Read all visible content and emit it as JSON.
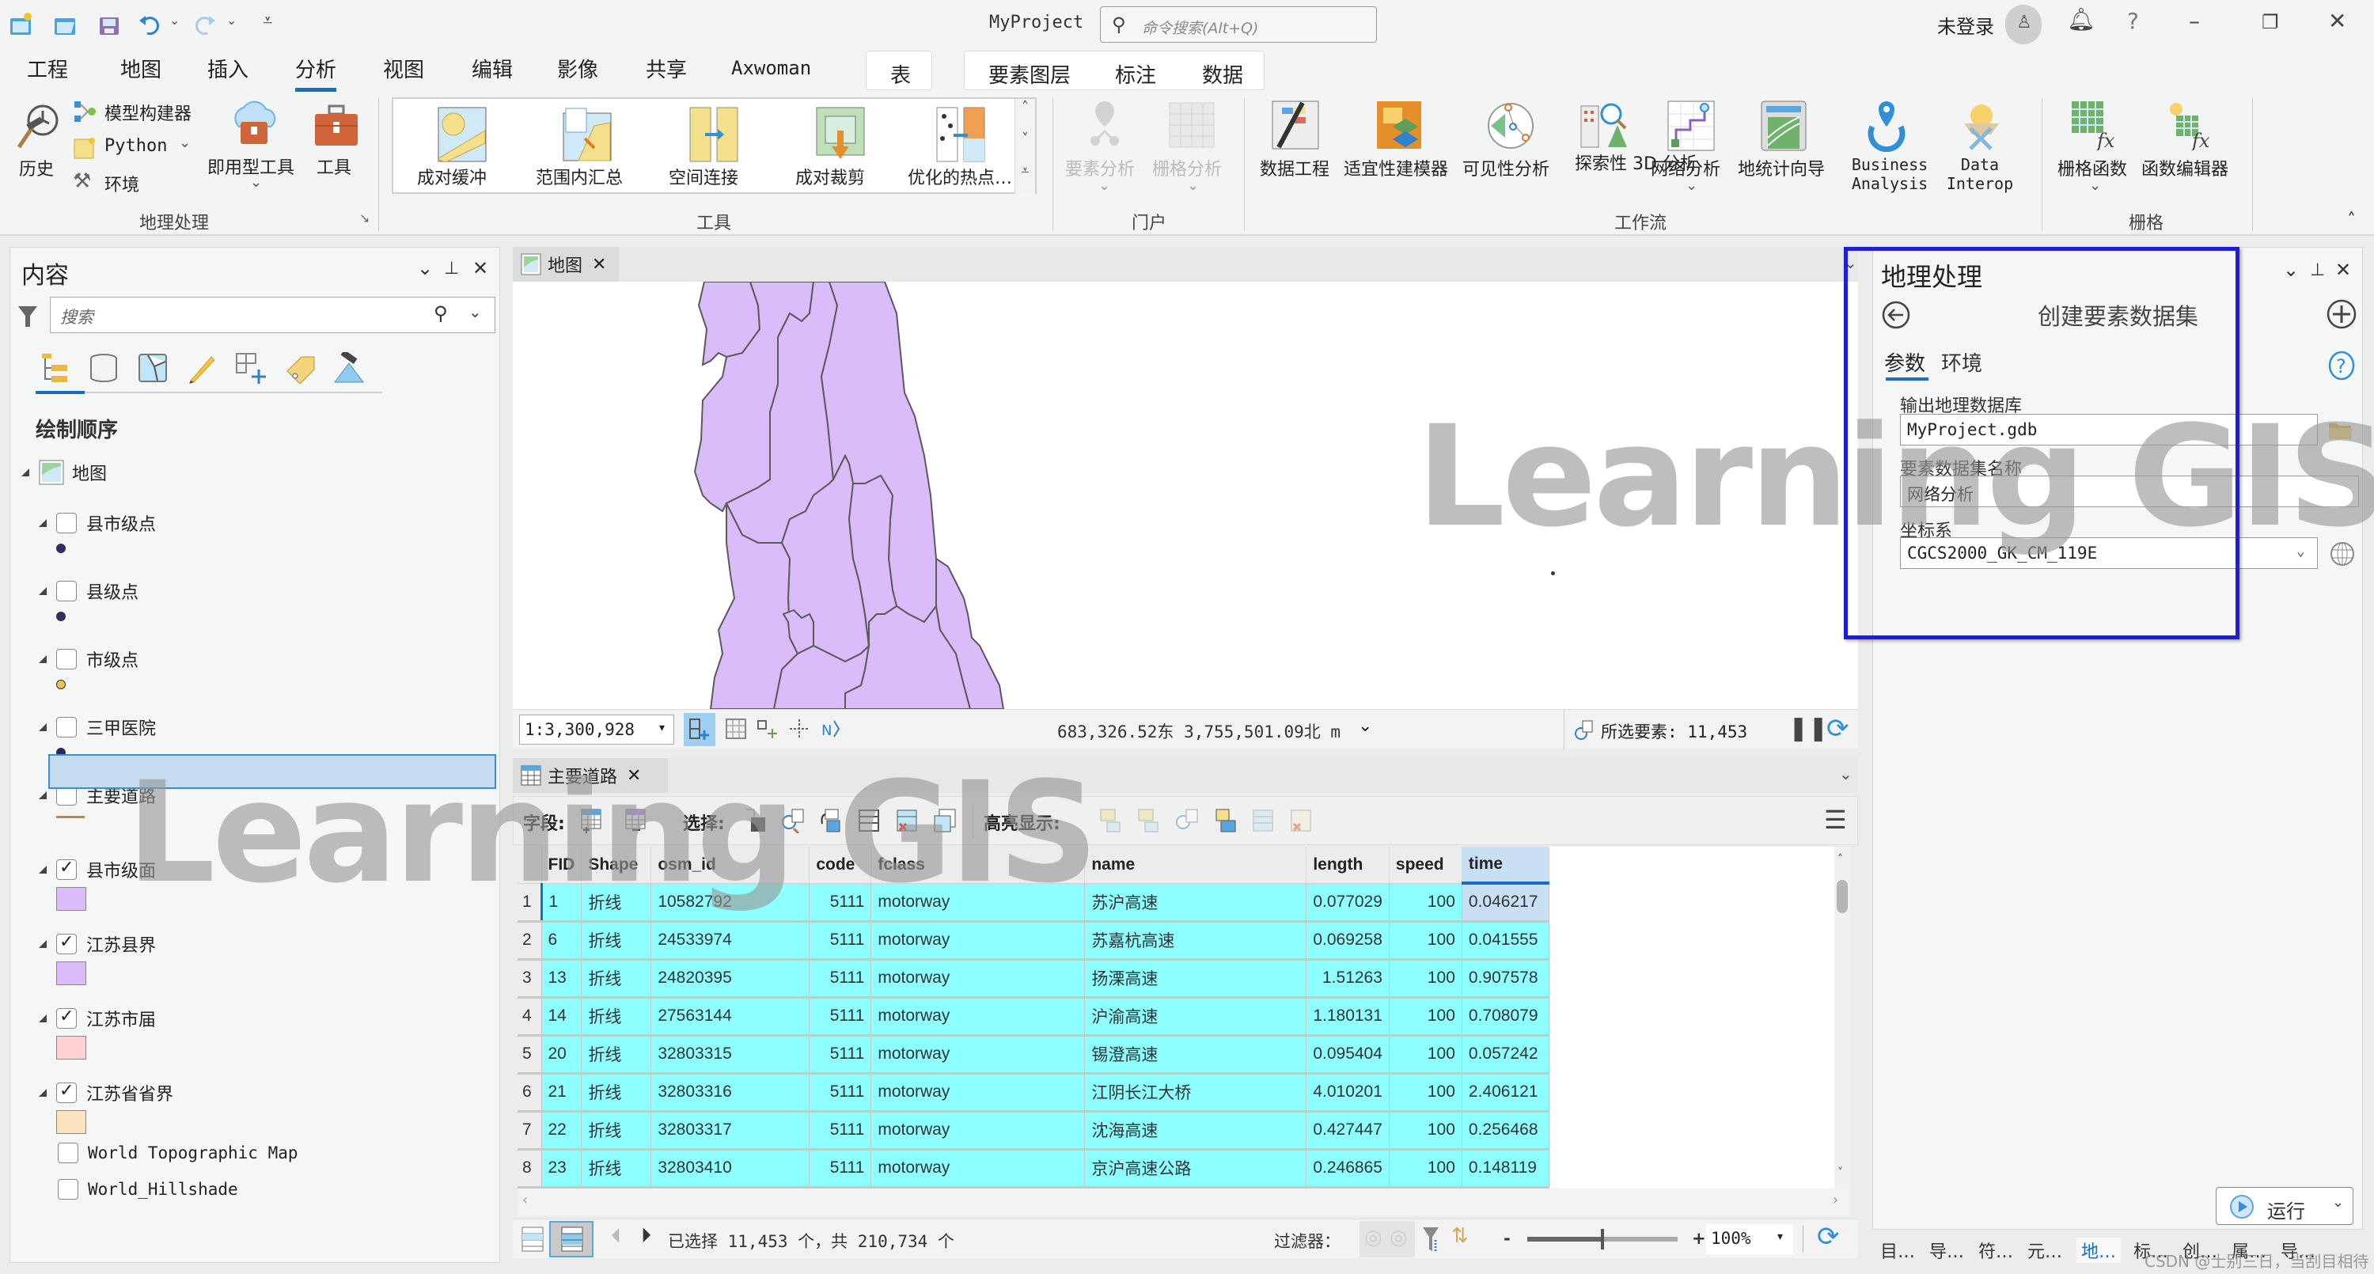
{
  "titlebar": {
    "project_name": "MyProject",
    "command_search_placeholder": "命令搜索(Alt+Q)",
    "user_status": "未登录",
    "help": "?"
  },
  "ribbon_tabs": {
    "items": [
      "工程",
      "地图",
      "插入",
      "分析",
      "视图",
      "编辑",
      "影像",
      "共享",
      "Axwoman"
    ],
    "active": "分析",
    "contextual": {
      "table": "表",
      "feature_layer_group": [
        "要素图层",
        "标注",
        "数据"
      ]
    }
  },
  "ribbon": {
    "geoprocessing": {
      "label": "地理处理",
      "history": "历史",
      "model_builder": "模型构建器",
      "python": "Python",
      "environments": "环境",
      "ready_tools": "即用型工具",
      "tools": "工具"
    },
    "tools_gallery": {
      "label": "工具",
      "items": [
        "成对缓冲",
        "范围内汇总",
        "空间连接",
        "成对裁剪",
        "优化的热点…"
      ]
    },
    "portal": {
      "label": "门户",
      "items": [
        "要素分析",
        "栅格分析"
      ]
    },
    "workflows": {
      "label": "工作流",
      "items": [
        "数据工程",
        "适宜性建模器",
        "可见性分析",
        "探索性 3D 分析",
        "网络分析",
        "地统计向导",
        "Business Analysis",
        "Data Interop"
      ]
    },
    "raster": {
      "label": "栅格",
      "items": [
        "栅格函数",
        "函数编辑器"
      ]
    }
  },
  "contents": {
    "title": "内容",
    "search_placeholder": "搜索",
    "section": "绘制顺序",
    "map_name": "地图",
    "layers": [
      {
        "name": "县市级点",
        "checked": false,
        "symbol": "dot",
        "color": "#3b2a6b"
      },
      {
        "name": "县级点",
        "checked": false,
        "symbol": "dot",
        "color": "#3b2a6b"
      },
      {
        "name": "市级点",
        "checked": false,
        "symbol": "dot",
        "color": "#e8c45a"
      },
      {
        "name": "三甲医院",
        "checked": false,
        "symbol": "dot",
        "color": "#1f2a6b"
      },
      {
        "name": "主要道路",
        "checked": false,
        "symbol": "line",
        "color": "#b8845a",
        "selected": true
      },
      {
        "name": "县市级面",
        "checked": true,
        "symbol": "fill",
        "color": "#dbbcfb"
      },
      {
        "name": "江苏县界",
        "checked": true,
        "symbol": "fill",
        "color": "#dbbcfb"
      },
      {
        "name": "江苏市届",
        "checked": true,
        "symbol": "fill",
        "color": "#fdd0d2"
      },
      {
        "name": "江苏省省界",
        "checked": true,
        "symbol": "fill",
        "color": "#fde3bd"
      }
    ],
    "basemaps": [
      {
        "name": "World Topographic Map",
        "checked": false
      },
      {
        "name": "World_Hillshade",
        "checked": false
      }
    ]
  },
  "map_view": {
    "tab_label": "地图",
    "scale": "1:3,300,928",
    "coordinates": "683,326.52东  3,755,501.09北 m",
    "selected_features": "所选要素: 11,453",
    "polygon_fill": "#dbbcfb"
  },
  "attribute_table": {
    "tab_label": "主要道路",
    "toolbar": {
      "field": "字段:",
      "select": "选择:",
      "highlight": "高亮显示:"
    },
    "columns": [
      "FID",
      "Shape",
      "osm_id",
      "code",
      "fclass",
      "name",
      "length",
      "speed",
      "time"
    ],
    "sorted_column": "time",
    "rows": [
      {
        "n": "1",
        "FID": "1",
        "Shape": "折线",
        "osm_id": "10582792",
        "code": "5111",
        "fclass": "motorway",
        "name": "苏沪高速",
        "length": "0.077029",
        "speed": "100",
        "time": "0.046217"
      },
      {
        "n": "2",
        "FID": "6",
        "Shape": "折线",
        "osm_id": "24533974",
        "code": "5111",
        "fclass": "motorway",
        "name": "苏嘉杭高速",
        "length": "0.069258",
        "speed": "100",
        "time": "0.041555"
      },
      {
        "n": "3",
        "FID": "13",
        "Shape": "折线",
        "osm_id": "24820395",
        "code": "5111",
        "fclass": "motorway",
        "name": "扬溧高速",
        "length": "1.51263",
        "speed": "100",
        "time": "0.907578"
      },
      {
        "n": "4",
        "FID": "14",
        "Shape": "折线",
        "osm_id": "27563144",
        "code": "5111",
        "fclass": "motorway",
        "name": "沪渝高速",
        "length": "1.180131",
        "speed": "100",
        "time": "0.708079"
      },
      {
        "n": "5",
        "FID": "20",
        "Shape": "折线",
        "osm_id": "32803315",
        "code": "5111",
        "fclass": "motorway",
        "name": "锡澄高速",
        "length": "0.095404",
        "speed": "100",
        "time": "0.057242"
      },
      {
        "n": "6",
        "FID": "21",
        "Shape": "折线",
        "osm_id": "32803316",
        "code": "5111",
        "fclass": "motorway",
        "name": "江阴长江大桥",
        "length": "4.010201",
        "speed": "100",
        "time": "2.406121"
      },
      {
        "n": "7",
        "FID": "22",
        "Shape": "折线",
        "osm_id": "32803317",
        "code": "5111",
        "fclass": "motorway",
        "name": "沈海高速",
        "length": "0.427447",
        "speed": "100",
        "time": "0.256468"
      },
      {
        "n": "8",
        "FID": "23",
        "Shape": "折线",
        "osm_id": "32803410",
        "code": "5111",
        "fclass": "motorway",
        "name": "京沪高速公路",
        "length": "0.246865",
        "speed": "100",
        "time": "0.148119"
      }
    ],
    "footer": {
      "selection_summary": "已选择 11,453 个，共 210,734 个",
      "filter_label": "过滤器：",
      "zoom_minus": "-",
      "zoom_plus": "+",
      "zoom_percent": "100%",
      "zoom_level": 0.5
    }
  },
  "geoprocessing": {
    "title": "地理处理",
    "tool_name": "创建要素数据集",
    "tabs": [
      "参数",
      "环境"
    ],
    "active_tab": "参数",
    "fields": {
      "output_gdb_label": "输出地理数据库",
      "output_gdb_value": "MyProject.gdb",
      "dataset_name_label": "要素数据集名称",
      "dataset_name_value": "网络分析",
      "coord_sys_label": "坐标系",
      "coord_sys_value": "CGCS2000_GK_CM_119E"
    },
    "run_label": "运行",
    "bottom_tabs": [
      "目…",
      "导…",
      "符…",
      "元…",
      "地…",
      "标…",
      "创…",
      "属…",
      "导…"
    ],
    "active_bottom_tab": "地…"
  },
  "watermark": {
    "text1": "Learning GIS",
    "credit": "CSDN @士别三日，当刮目相待"
  },
  "colors": {
    "accent": "#1a6ec1",
    "selection_row": "#8effff",
    "highlight_outline": "#1e1ed4"
  }
}
